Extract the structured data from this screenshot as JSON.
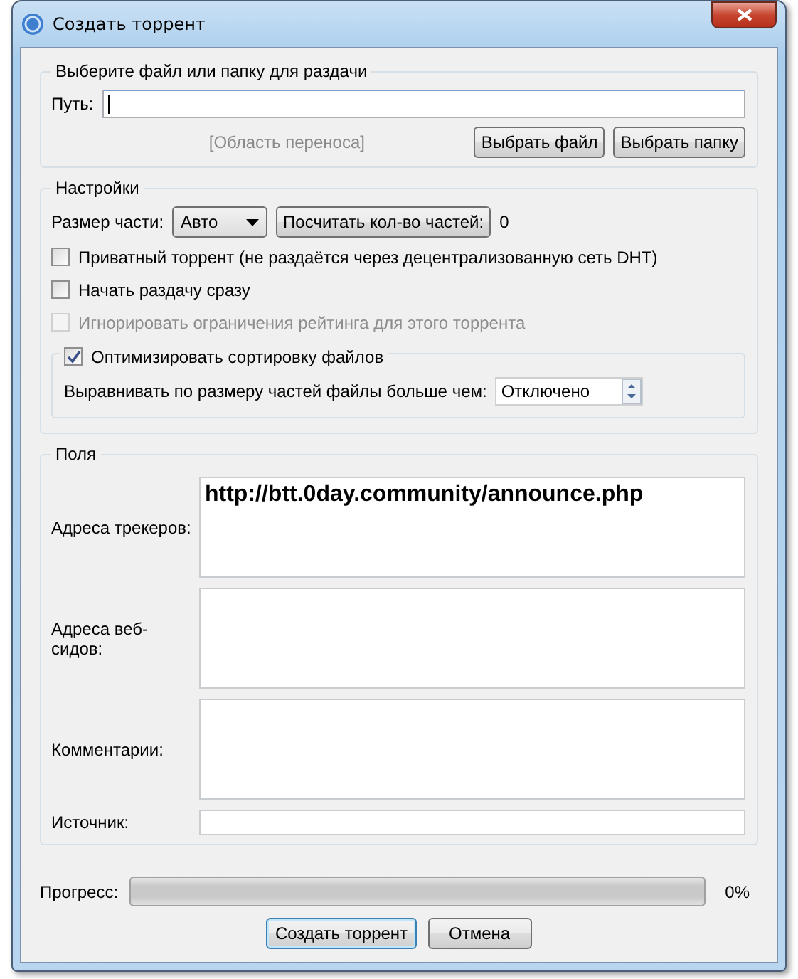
{
  "window": {
    "title": "Создать торрент"
  },
  "source_group": {
    "title": "Выберите файл или папку для раздачи",
    "path_label": "Путь:",
    "drop_area": "[Область переноса]",
    "buttons": [
      "Выбрать файл",
      "Выбрать папку"
    ]
  },
  "settings": {
    "title": "Настройки",
    "piece_size_label": "Размер части:",
    "piece_size": "Авто",
    "calc_button": "Посчитать кол-во частей:",
    "piece_count": "0",
    "options": [
      {
        "label": "Приватный торрент (не раздаётся через децентрализованную сеть DHT)",
        "checked": false,
        "disabled": false
      },
      {
        "label": "Начать раздачу сразу",
        "checked": false,
        "disabled": false
      },
      {
        "label": "Игнорировать ограничения рейтинга для этого торрента",
        "checked": false,
        "disabled": true
      }
    ],
    "optimize": {
      "label": "Оптимизировать сортировку файлов",
      "checked": true,
      "align_label": "Выравнивать по размеру частей файлы больше чем:",
      "align_value": "Отключено"
    }
  },
  "fields": {
    "title": "Поля",
    "rows": [
      {
        "label": "Адреса трекеров:",
        "kind": "multiline",
        "value": "http://btt.0day.community/announce.php"
      },
      {
        "label": "Адреса веб-сидов:",
        "kind": "multiline"
      },
      {
        "label": "Комментарии:",
        "kind": "multiline"
      },
      {
        "label": "Источник:",
        "kind": "single"
      }
    ]
  },
  "progress": {
    "label": "Прогресс:",
    "level": 0,
    "reading": "0%"
  },
  "buttons": [
    {
      "label": "Создать торрент",
      "focused": true
    },
    {
      "label": "Отмена",
      "focused": false
    }
  ]
}
